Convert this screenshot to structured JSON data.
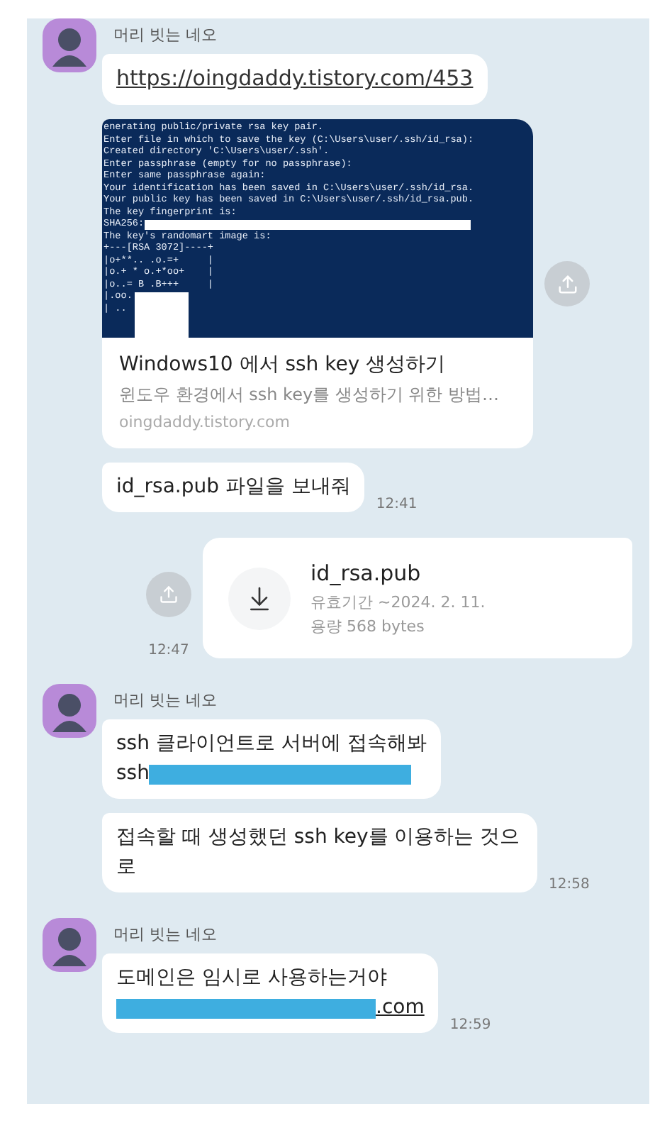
{
  "groups": [
    {
      "outgoing": false,
      "sender": "머리 빗는 네오",
      "messages": [
        {
          "kind": "link",
          "text": "https://oingdaddy.tistory.com/453"
        },
        {
          "kind": "preview",
          "terminal_lines": [
            {
              "text": "enerating public/private rsa key pair.",
              "redacted": false
            },
            {
              "text": "Enter file in which to save the key (C:\\Users\\user/.ssh/id_rsa):",
              "redacted": false
            },
            {
              "text": "Created directory 'C:\\Users\\user/.ssh'.",
              "redacted": false
            },
            {
              "text": "Enter passphrase (empty for no passphrase):",
              "redacted": false
            },
            {
              "text": "Enter same passphrase again:",
              "redacted": false
            },
            {
              "text": "Your identification has been saved in C:\\Users\\user/.ssh/id_rsa.",
              "redacted": false
            },
            {
              "text": "Your public key has been saved in C:\\Users\\user/.ssh/id_rsa.pub.",
              "redacted": false
            },
            {
              "text": "The key fingerprint is:",
              "redacted": false
            },
            {
              "text": "SHA256:",
              "redacted": true
            },
            {
              "text": "The key's randomart image is:",
              "redacted": false
            },
            {
              "text": "+---[RSA 3072]----+",
              "redacted": false
            },
            {
              "text": "|o+**.. .o.=+     |",
              "redacted": false
            },
            {
              "text": "|o.+ * o.+*oo+    |",
              "redacted": false
            },
            {
              "text": "|o..= B .B+++     |",
              "redacted": false
            },
            {
              "text": "|.oo.",
              "redacted": false
            },
            {
              "text": "| ..",
              "redacted": false
            }
          ],
          "title": "Windows10 에서 ssh key 생성하기",
          "description": "윈도우 환경에서 ssh key를 생성하기 위한 방법…",
          "domain": "oingdaddy.tistory.com"
        },
        {
          "kind": "text",
          "lines": [
            [
              {
                "kind": "text",
                "text": "id_rsa.pub 파일을 보내줘"
              }
            ]
          ],
          "time": "12:41"
        }
      ]
    },
    {
      "outgoing": true,
      "messages": [
        {
          "kind": "file",
          "name": "id_rsa.pub",
          "expiry_label": "유효기간",
          "expiry": "~2024. 2. 11.",
          "size_label": "용량",
          "size": "568 bytes",
          "time": "12:47"
        }
      ]
    },
    {
      "outgoing": false,
      "sender": "머리 빗는 네오",
      "messages": [
        {
          "kind": "text",
          "lines": [
            [
              {
                "kind": "text",
                "text": "ssh 클라이언트로 서버에 접속해봐"
              }
            ],
            [
              {
                "kind": "text",
                "text": "ssh"
              },
              {
                "kind": "redaction"
              }
            ]
          ]
        },
        {
          "kind": "text",
          "lines": [
            [
              {
                "kind": "text",
                "text": "접속할 때 생성했던 ssh key를 이용하는 것으로"
              }
            ]
          ],
          "time": "12:58"
        }
      ]
    },
    {
      "outgoing": false,
      "sender": "머리 빗는 네오",
      "messages": [
        {
          "kind": "text",
          "lines": [
            [
              {
                "kind": "text",
                "text": "도메인은 임시로 사용하는거야"
              }
            ],
            [
              {
                "kind": "redaction"
              },
              {
                "kind": "link",
                "text": ".com"
              }
            ]
          ],
          "time": "12:59"
        }
      ]
    }
  ]
}
